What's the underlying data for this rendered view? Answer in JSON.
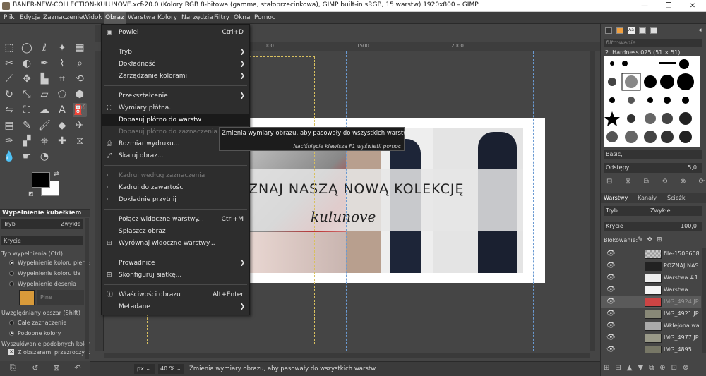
{
  "window": {
    "title": "BANER-NEW-COLLECTION-KULUNOVE.xcf-20.0 (Kolory RGB 8-bitowa (gamma, stałoprzecinkowa), GIMP built-in sRGB, 15 warstw) 1920x800 – GIMP",
    "min": "—",
    "max": "❐",
    "close": "✕"
  },
  "menubar": [
    "Plik",
    "Edycja",
    "Zaznaczenie",
    "Widok",
    "Obraz",
    "Warstwa",
    "Kolory",
    "Narzędzia",
    "Filtry",
    "Okna",
    "Pomoc"
  ],
  "image_menu": {
    "items": [
      {
        "label": "Powiel",
        "shortcut": "Ctrl+D",
        "icon": "duplicate-icon",
        "glyph": "▣"
      },
      {
        "label": "Tryb",
        "submenu": true
      },
      {
        "label": "Dokładność",
        "submenu": true
      },
      {
        "label": "Zarządzanie kolorami",
        "submenu": true
      },
      {
        "label": "Przekształcenie",
        "submenu": true
      },
      {
        "label": "Wymiary płótna...",
        "icon": "canvas-size-icon",
        "glyph": "⬚"
      },
      {
        "label": "Dopasuj płótno do warstw",
        "highlighted": true
      },
      {
        "label": "Dopasuj płótno do zaznaczenia",
        "disabled": true
      },
      {
        "label": "Rozmiar wydruku...",
        "icon": "print-size-icon",
        "glyph": "⎙"
      },
      {
        "label": "Skaluj obraz...",
        "icon": "scale-image-icon",
        "glyph": "⤢"
      },
      {
        "label": "Kadruj według zaznaczenia",
        "disabled": true,
        "icon": "crop-selection-icon",
        "glyph": "⌗"
      },
      {
        "label": "Kadruj do zawartości",
        "icon": "crop-content-icon",
        "glyph": "⌗"
      },
      {
        "label": "Dokładnie przytnij",
        "icon": "zealous-crop-icon",
        "glyph": "⌗"
      },
      {
        "label": "Połącz widoczne warstwy...",
        "shortcut": "Ctrl+M"
      },
      {
        "label": "Spłaszcz obraz"
      },
      {
        "label": "Wyrównaj widoczne warstwy...",
        "icon": "align-layers-icon",
        "glyph": "⊞"
      },
      {
        "label": "Prowadnice",
        "submenu": true
      },
      {
        "label": "Skonfiguruj siatkę...",
        "icon": "grid-icon",
        "glyph": "⊞"
      },
      {
        "label": "Właściwości obrazu",
        "shortcut": "Alt+Enter",
        "icon": "info-icon",
        "glyph": "ⓘ"
      },
      {
        "label": "Metadane",
        "submenu": true
      }
    ]
  },
  "tooltip": {
    "text": "Zmienia wymiary obrazu, aby pasowały do wszystkich warstw",
    "hint": "Naciśnięcie klawisza F1 wyświetli pomoc"
  },
  "banner": {
    "headline": "ZNAJ NASZĄ NOWĄ KOLEKCJĘ",
    "script_logo": "kulunove"
  },
  "ruler": {
    "top": [
      "1000",
      "1500",
      "2000"
    ]
  },
  "tool_options": {
    "title": "Wypełnienie kubełkiem",
    "mode_label": "Tryb",
    "mode_value": "Zwykłe",
    "opacity_label": "Krycie",
    "fill_type_label": "Typ wypełnienia (Ctrl)",
    "fill_fg": "Wypełnienie koloru pierws",
    "fill_bg": "Wypełnienie koloru tła",
    "fill_pattern": "Wypełnienie desenia",
    "pattern_name": "Pine",
    "area_label": "Uwzględniany obszar (Shift)",
    "area_whole": "Całe zaznaczenie",
    "area_similar": "Podobne kolory",
    "similar_label": "Wyszukiwanie podobnych kolorów",
    "merged": "Z obszarami przezroczysty"
  },
  "statusbar": {
    "unit": "px",
    "zoom": "40 %",
    "message": "Zmienia wymiary obrazu, aby pasowały do wszystkich warstw"
  },
  "brushes": {
    "filter_placeholder": "filtrowanie",
    "brush_name": "2. Hardness 025 (51 × 51)",
    "preset": "Basic,",
    "spacing_label": "Odstępy",
    "spacing_value": "5,0"
  },
  "layers": {
    "tabs": [
      "Warstwy",
      "Kanały",
      "Ścieżki"
    ],
    "mode_label": "Tryb",
    "mode_value": "Zwykłe",
    "opacity_label": "Krycie",
    "opacity_value": "100,0",
    "lock_label": "Blokowanie:",
    "items": [
      "file-15086089",
      "POZNAJ NAS",
      "Warstwa #1",
      "Warstwa",
      "IMG_4924.JP",
      "IMG_4921.JP",
      "Wklejona war",
      "IMG_4977.JP",
      "IMG_4895"
    ]
  }
}
